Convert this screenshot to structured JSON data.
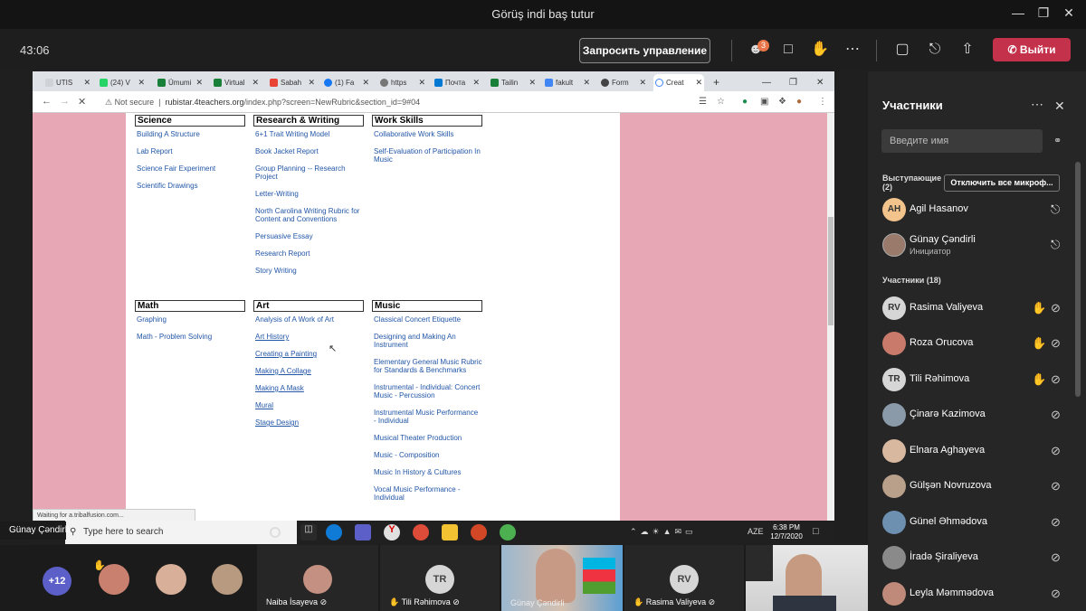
{
  "window": {
    "title": "Görüş indi baş tutur"
  },
  "toolbar": {
    "timer": "43:06",
    "request_control": "Запросить управление",
    "participants_badge": "3",
    "leave": "Выйти"
  },
  "browser": {
    "tabs": [
      {
        "label": "UTIS",
        "color": "#cfd3d8"
      },
      {
        "label": "(24) V",
        "color": "#25d366"
      },
      {
        "label": "Ümumi",
        "color": "#188038"
      },
      {
        "label": "Virtual",
        "color": "#188038"
      },
      {
        "label": "Sabah",
        "color": "#ea4335"
      },
      {
        "label": "(1) Fa",
        "color": "#1877f2"
      },
      {
        "label": "https",
        "color": "#777777"
      },
      {
        "label": "Почта",
        "color": "#0078d4"
      },
      {
        "label": "Tailin",
        "color": "#188038"
      },
      {
        "label": "fakult",
        "color": "#4285f4"
      },
      {
        "label": "Form",
        "color": "#444444"
      },
      {
        "label": "Creat",
        "color": "#4285f4"
      }
    ],
    "not_secure": "Not secure",
    "url_host": "rubistar.4teachers.org",
    "url_path": "/index.php?screen=NewRubric&section_id=9#04",
    "status": "Waiting for a.tribalfusion.com..."
  },
  "rubric": {
    "science": {
      "title": "Science",
      "links": [
        "Building A Structure",
        "Lab Report",
        "Science Fair Experiment",
        "Scientific Drawings"
      ]
    },
    "writing": {
      "title": "Research & Writing",
      "links": [
        "6+1 Trait Writing Model",
        "Book Jacket Report",
        "Group Planning -- Research Project",
        "Letter-Writing",
        "North Carolina Writing Rubric for Content and Conventions",
        "Persuasive Essay",
        "Research Report",
        "Story Writing"
      ]
    },
    "work": {
      "title": "Work Skills",
      "links": [
        "Collaborative Work Skills",
        "Self-Evaluation of Participation In Music"
      ]
    },
    "math": {
      "title": "Math",
      "links": [
        "Graphing",
        "Math - Problem Solving"
      ]
    },
    "art": {
      "title": "Art",
      "links": [
        "Analysis of A Work of Art",
        "Art History",
        "Creating a Painting",
        "Making A Collage",
        "Making A Mask",
        "Mural",
        "Stage Design"
      ]
    },
    "music": {
      "title": "Music",
      "links": [
        "Classical Concert Etiquette",
        "Designing and Making An Instrument",
        "Elementary General Music Rubric for Standards & Benchmarks",
        "Instrumental - Individual: Concert Music - Percussion",
        "Instrumental Music Performance - Individual",
        "Musical Theater Production",
        "Music - Composition",
        "Music In History & Cultures",
        "Vocal Music Performance - Individual"
      ]
    }
  },
  "taskbar": {
    "search": "Type here to search",
    "lang": "AZE",
    "time": "6:38 PM",
    "date": "12/7/2020"
  },
  "presenter": "Günay Çəndirli",
  "panel": {
    "title": "Участники",
    "search_placeholder": "Введите имя",
    "presenters_label": "Выступающие (2)",
    "mute_all": "Отключить все микроф...",
    "attendees_label": "Участники (18)",
    "presenters": [
      {
        "name": "Agil Hasanov",
        "initials": "AH"
      },
      {
        "name": "Günay Çəndirli",
        "role": "Инициатор"
      }
    ],
    "attendees": [
      {
        "name": "Rasima Valiyeva",
        "initials": "RV",
        "hand": true
      },
      {
        "name": "Roza Orucova",
        "hand": true
      },
      {
        "name": "Tili Rəhimova",
        "initials": "TR",
        "hand": true
      },
      {
        "name": "Çinarə Kazimova",
        "hand": false
      },
      {
        "name": "Elnara Aghayeva",
        "hand": false
      },
      {
        "name": "Gülşən Novruzova",
        "hand": false
      },
      {
        "name": "Günel Əhmədova",
        "hand": false
      },
      {
        "name": "İradə Şiraliyeva",
        "hand": false
      },
      {
        "name": "Leyla Məmmədova",
        "hand": false
      }
    ]
  },
  "strip": {
    "more": "+12",
    "tiles": [
      {
        "name": "Naiba İsayeva"
      },
      {
        "name": "Tili Rəhimova",
        "initials": "TR"
      },
      {
        "name": "Günay Çəndirli"
      },
      {
        "name": "Rasima Valiyeva",
        "initials": "RV"
      }
    ]
  }
}
